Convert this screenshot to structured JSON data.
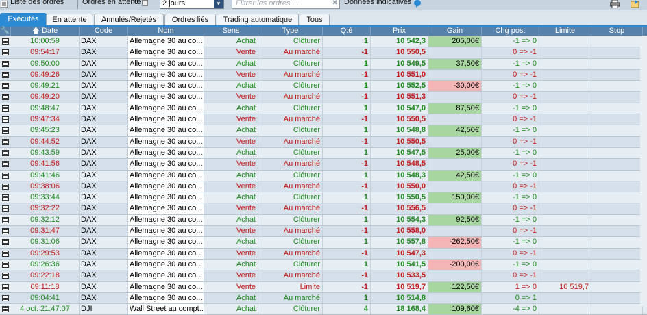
{
  "topbar": {
    "orders_list": "Liste des ordres",
    "pending_label": "Ordres en attente :",
    "pending_count": "0",
    "period": "2 jours",
    "filter_placeholder": "Filtrer les ordres ...",
    "indicative": "Données indicatives"
  },
  "tabs": [
    "Exécutés",
    "En attente",
    "Annulés/Rejetés",
    "Ordres liés",
    "Trading automatique",
    "Tous"
  ],
  "columns": [
    "Date",
    "Code",
    "Nom",
    "Sens",
    "Type",
    "Qté",
    "Prix",
    "Gain",
    "Chg pos.",
    "Limite",
    "Stop"
  ],
  "rows": [
    {
      "date": "10:00:59",
      "code": "DAX",
      "nom": "Allemagne 30 au co...",
      "sens": "Achat",
      "type": "Clôturer",
      "qte": "1",
      "prix": "10 542,3",
      "gain": "205,00€",
      "chg": "-1 => 0",
      "limite": "",
      "stop": ""
    },
    {
      "date": "09:54:17",
      "code": "DAX",
      "nom": "Allemagne 30 au co...",
      "sens": "Vente",
      "type": "Au marché",
      "qte": "-1",
      "prix": "10 550,5",
      "gain": "",
      "chg": "0 => -1",
      "limite": "",
      "stop": ""
    },
    {
      "date": "09:50:00",
      "code": "DAX",
      "nom": "Allemagne 30 au co...",
      "sens": "Achat",
      "type": "Clôturer",
      "qte": "1",
      "prix": "10 549,5",
      "gain": "37,50€",
      "chg": "-1 => 0",
      "limite": "",
      "stop": ""
    },
    {
      "date": "09:49:26",
      "code": "DAX",
      "nom": "Allemagne 30 au co...",
      "sens": "Vente",
      "type": "Au marché",
      "qte": "-1",
      "prix": "10 551,0",
      "gain": "",
      "chg": "0 => -1",
      "limite": "",
      "stop": ""
    },
    {
      "date": "09:49:21",
      "code": "DAX",
      "nom": "Allemagne 30 au co...",
      "sens": "Achat",
      "type": "Clôturer",
      "qte": "1",
      "prix": "10 552,5",
      "gain": "-30,00€",
      "chg": "-1 => 0",
      "limite": "",
      "stop": ""
    },
    {
      "date": "09:49:20",
      "code": "DAX",
      "nom": "Allemagne 30 au co...",
      "sens": "Vente",
      "type": "Au marché",
      "qte": "-1",
      "prix": "10 551,3",
      "gain": "",
      "chg": "0 => -1",
      "limite": "",
      "stop": ""
    },
    {
      "date": "09:48:47",
      "code": "DAX",
      "nom": "Allemagne 30 au co...",
      "sens": "Achat",
      "type": "Clôturer",
      "qte": "1",
      "prix": "10 547,0",
      "gain": "87,50€",
      "chg": "-1 => 0",
      "limite": "",
      "stop": ""
    },
    {
      "date": "09:47:34",
      "code": "DAX",
      "nom": "Allemagne 30 au co...",
      "sens": "Vente",
      "type": "Au marché",
      "qte": "-1",
      "prix": "10 550,5",
      "gain": "",
      "chg": "0 => -1",
      "limite": "",
      "stop": ""
    },
    {
      "date": "09:45:23",
      "code": "DAX",
      "nom": "Allemagne 30 au co...",
      "sens": "Achat",
      "type": "Clôturer",
      "qte": "1",
      "prix": "10 548,8",
      "gain": "42,50€",
      "chg": "-1 => 0",
      "limite": "",
      "stop": ""
    },
    {
      "date": "09:44:52",
      "code": "DAX",
      "nom": "Allemagne 30 au co...",
      "sens": "Vente",
      "type": "Au marché",
      "qte": "-1",
      "prix": "10 550,5",
      "gain": "",
      "chg": "0 => -1",
      "limite": "",
      "stop": ""
    },
    {
      "date": "09:43:59",
      "code": "DAX",
      "nom": "Allemagne 30 au co...",
      "sens": "Achat",
      "type": "Clôturer",
      "qte": "1",
      "prix": "10 547,5",
      "gain": "25,00€",
      "chg": "-1 => 0",
      "limite": "",
      "stop": ""
    },
    {
      "date": "09:41:56",
      "code": "DAX",
      "nom": "Allemagne 30 au co...",
      "sens": "Vente",
      "type": "Au marché",
      "qte": "-1",
      "prix": "10 548,5",
      "gain": "",
      "chg": "0 => -1",
      "limite": "",
      "stop": ""
    },
    {
      "date": "09:41:46",
      "code": "DAX",
      "nom": "Allemagne 30 au co...",
      "sens": "Achat",
      "type": "Clôturer",
      "qte": "1",
      "prix": "10 548,3",
      "gain": "42,50€",
      "chg": "-1 => 0",
      "limite": "",
      "stop": ""
    },
    {
      "date": "09:38:06",
      "code": "DAX",
      "nom": "Allemagne 30 au co...",
      "sens": "Vente",
      "type": "Au marché",
      "qte": "-1",
      "prix": "10 550,0",
      "gain": "",
      "chg": "0 => -1",
      "limite": "",
      "stop": ""
    },
    {
      "date": "09:33:44",
      "code": "DAX",
      "nom": "Allemagne 30 au co...",
      "sens": "Achat",
      "type": "Clôturer",
      "qte": "1",
      "prix": "10 550,5",
      "gain": "150,00€",
      "chg": "-1 => 0",
      "limite": "",
      "stop": ""
    },
    {
      "date": "09:32:22",
      "code": "DAX",
      "nom": "Allemagne 30 au co...",
      "sens": "Vente",
      "type": "Au marché",
      "qte": "-1",
      "prix": "10 556,5",
      "gain": "",
      "chg": "0 => -1",
      "limite": "",
      "stop": ""
    },
    {
      "date": "09:32:12",
      "code": "DAX",
      "nom": "Allemagne 30 au co...",
      "sens": "Achat",
      "type": "Clôturer",
      "qte": "1",
      "prix": "10 554,3",
      "gain": "92,50€",
      "chg": "-1 => 0",
      "limite": "",
      "stop": ""
    },
    {
      "date": "09:31:47",
      "code": "DAX",
      "nom": "Allemagne 30 au co...",
      "sens": "Vente",
      "type": "Au marché",
      "qte": "-1",
      "prix": "10 558,0",
      "gain": "",
      "chg": "0 => -1",
      "limite": "",
      "stop": ""
    },
    {
      "date": "09:31:06",
      "code": "DAX",
      "nom": "Allemagne 30 au co...",
      "sens": "Achat",
      "type": "Clôturer",
      "qte": "1",
      "prix": "10 557,8",
      "gain": "-262,50€",
      "chg": "-1 => 0",
      "limite": "",
      "stop": ""
    },
    {
      "date": "09:29:53",
      "code": "DAX",
      "nom": "Allemagne 30 au co...",
      "sens": "Vente",
      "type": "Au marché",
      "qte": "-1",
      "prix": "10 547,3",
      "gain": "",
      "chg": "0 => -1",
      "limite": "",
      "stop": ""
    },
    {
      "date": "09:26:36",
      "code": "DAX",
      "nom": "Allemagne 30 au co...",
      "sens": "Achat",
      "type": "Clôturer",
      "qte": "1",
      "prix": "10 541,5",
      "gain": "-200,00€",
      "chg": "-1 => 0",
      "limite": "",
      "stop": ""
    },
    {
      "date": "09:22:18",
      "code": "DAX",
      "nom": "Allemagne 30 au co...",
      "sens": "Vente",
      "type": "Au marché",
      "qte": "-1",
      "prix": "10 533,5",
      "gain": "",
      "chg": "0 => -1",
      "limite": "",
      "stop": ""
    },
    {
      "date": "09:11:18",
      "code": "DAX",
      "nom": "Allemagne 30 au co...",
      "sens": "Vente",
      "type": "Limite",
      "qte": "-1",
      "prix": "10 519,7",
      "gain": "122,50€",
      "chg": "1 => 0",
      "limite": "10 519,7",
      "stop": ""
    },
    {
      "date": "09:04:41",
      "code": "DAX",
      "nom": "Allemagne 30 au co...",
      "sens": "Achat",
      "type": "Au marché",
      "qte": "1",
      "prix": "10 514,8",
      "gain": "",
      "chg": "0 => 1",
      "limite": "",
      "stop": ""
    },
    {
      "date": "4 oct. 21:47:07",
      "code": "DJI",
      "nom": "Wall Street au compt...",
      "sens": "Achat",
      "type": "Clôturer",
      "qte": "4",
      "prix": "18 168,4",
      "gain": "109,60€",
      "chg": "-4 => 0",
      "limite": "",
      "stop": ""
    }
  ],
  "colors": {
    "accent": "#2a8ad4",
    "header": "#5681ab",
    "green": "#1f8a1f",
    "red": "#c41a1a",
    "gain_pos": "#a8d6a1",
    "gain_neg": "#f3b5b5"
  }
}
